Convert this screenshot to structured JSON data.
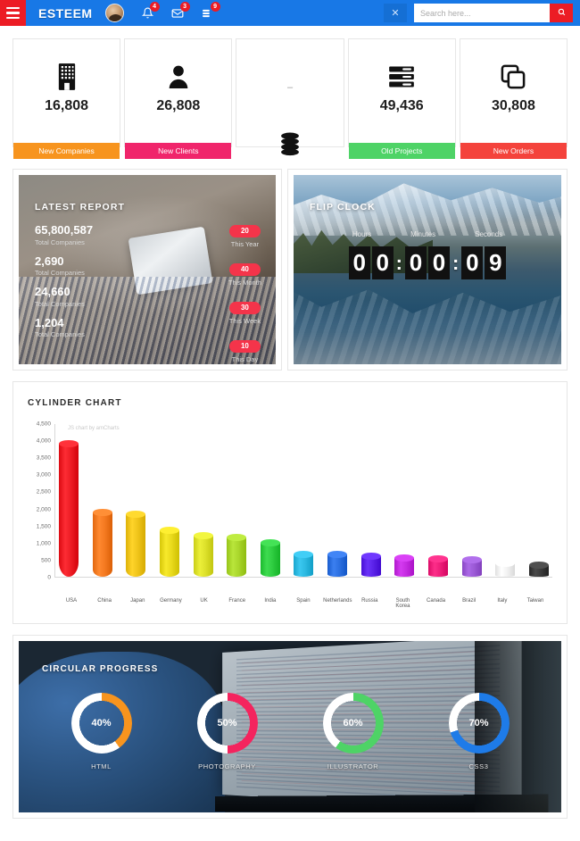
{
  "header": {
    "menu_icon": "hamburger-menu-icon",
    "brand": "ESTEEM",
    "avatar": "user-avatar",
    "notifications": {
      "icon": "bell-icon",
      "badge": "4"
    },
    "messages": {
      "icon": "envelope-icon",
      "badge": "3"
    },
    "tasks": {
      "icon": "tasks-icon",
      "badge": "9"
    },
    "close_label": "✕",
    "search": {
      "placeholder": "Search here...",
      "value": "",
      "button_icon": "search-icon"
    }
  },
  "stats": [
    {
      "icon": "building-icon",
      "value": "16,808",
      "label": "New Companies",
      "color": "#F7941E"
    },
    {
      "icon": "user-icon",
      "value": "26,808",
      "label": "New Clients",
      "color": "#F0256B"
    },
    {
      "icon": "database-icon",
      "value": "–",
      "label": "",
      "color": ""
    },
    {
      "icon": "server-icon",
      "value": "49,436",
      "label": "Old Projects",
      "color": "#4ED366"
    },
    {
      "icon": "copy-icon",
      "value": "30,808",
      "label": "New Orders",
      "color": "#F4433C"
    }
  ],
  "latest_report": {
    "title": "LATEST REPORT",
    "items": [
      {
        "value": "65,800,587",
        "label": "Total Companies"
      },
      {
        "value": "2,690",
        "label": "Total Companies"
      },
      {
        "value": "24,660",
        "label": "Total Companies"
      },
      {
        "value": "1,204",
        "label": "Total Companies"
      }
    ],
    "badges": [
      {
        "count": "20",
        "label": "This Year"
      },
      {
        "count": "40",
        "label": "This Month"
      },
      {
        "count": "30",
        "label": "This Week"
      },
      {
        "count": "10",
        "label": "This Day"
      }
    ]
  },
  "flip_clock": {
    "title": "FLIP CLOCK",
    "labels": [
      "Hours",
      "Minutes",
      "Seconds"
    ],
    "hours": [
      "0",
      "0"
    ],
    "minutes": [
      "0",
      "0"
    ],
    "seconds": [
      "0",
      "9"
    ],
    "separator": ":"
  },
  "chart_panel": {
    "title": "CYLINDER CHART",
    "watermark": "JS chart by amCharts"
  },
  "chart_data": {
    "type": "bar",
    "title": "CYLINDER CHART",
    "xlabel": "",
    "ylabel": "",
    "ylim": [
      0,
      4500
    ],
    "yticks": [
      "4,500",
      "4,000",
      "3,500",
      "3,000",
      "2,500",
      "2,000",
      "1,500",
      "1,000",
      "500",
      "0"
    ],
    "grid": false,
    "legend": "none",
    "categories": [
      "USA",
      "China",
      "Japan",
      "Germany",
      "UK",
      "France",
      "India",
      "Spain",
      "Netherlands",
      "Russia",
      "South Korea",
      "Canada",
      "Brazil",
      "Italy",
      "Taiwan"
    ],
    "values": [
      4100,
      1980,
      1930,
      1440,
      1260,
      1220,
      1050,
      700,
      680,
      620,
      580,
      560,
      520,
      420,
      370
    ],
    "colors": [
      "#ED1C24",
      "#F47920",
      "#EFC41A",
      "#E8D91B",
      "#DCE02A",
      "#A9D62B",
      "#2ECC40",
      "#2BB8E0",
      "#2B6FE0",
      "#5A22E8",
      "#C42BE0",
      "#ED1E79",
      "#9B59D6",
      "#F2F2F2",
      "#3A3A3A"
    ]
  },
  "circular_progress": {
    "title": "CIRCULAR PROGRESS",
    "items": [
      {
        "percent": 40,
        "percent_label": "40%",
        "label": "HTML",
        "color": "#F7941E"
      },
      {
        "percent": 50,
        "percent_label": "50%",
        "label": "PHOTOGRAPHY",
        "color": "#F4245E"
      },
      {
        "percent": 60,
        "percent_label": "60%",
        "label": "ILLUSTRATOR",
        "color": "#4ED366"
      },
      {
        "percent": 70,
        "percent_label": "70%",
        "label": "CSS3",
        "color": "#1E7BE8"
      }
    ]
  }
}
